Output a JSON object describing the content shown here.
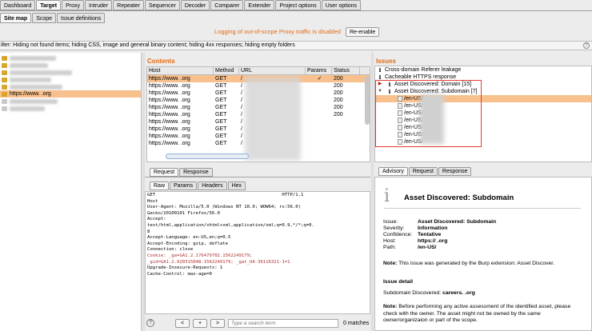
{
  "main_tabs": [
    "Dashboard",
    "Target",
    "Proxy",
    "Intruder",
    "Repeater",
    "Sequencer",
    "Decoder",
    "Comparer",
    "Extender",
    "Project options",
    "User options"
  ],
  "main_tab_active": "Target",
  "sub_tabs": [
    "Site map",
    "Scope",
    "Issue definitions"
  ],
  "scope_message": "Logging of out-of-scope Proxy traffic is disabled",
  "reenable_label": "Re-enable",
  "filter_text": "ilter: Hiding not found items;  hiding CSS, image and general binary content;  hiding 4xx responses;  hiding empty folders",
  "help_icon": "?",
  "site_tree": {
    "selected_label": "https://www.              .org"
  },
  "contents": {
    "title": "Contents",
    "columns": [
      "Host",
      "Method",
      "URL",
      "Params",
      "Status"
    ],
    "rows": [
      {
        "host": "https://www.          .org",
        "method": "GET",
        "url": "/",
        "params": "✓",
        "status": "200"
      },
      {
        "host": "https://www.          .org",
        "method": "GET",
        "url": "/",
        "params": "",
        "status": "200"
      },
      {
        "host": "https://www.          .org",
        "method": "GET",
        "url": "/",
        "params": "",
        "status": "200"
      },
      {
        "host": "https://www.          .org",
        "method": "GET",
        "url": "/",
        "params": "",
        "status": "200"
      },
      {
        "host": "https://www.          .org",
        "method": "GET",
        "url": "/",
        "params": "",
        "status": "200"
      },
      {
        "host": "https://www.          .org",
        "method": "GET",
        "url": "/",
        "params": "",
        "status": "200"
      },
      {
        "host": "https://www.          .org",
        "method": "GET",
        "url": "/",
        "params": "",
        "status": ""
      },
      {
        "host": "https://www.          .org",
        "method": "GET",
        "url": "/",
        "params": "",
        "status": ""
      },
      {
        "host": "https://www.          .org",
        "method": "GET",
        "url": "/",
        "params": "",
        "status": ""
      },
      {
        "host": "https://www.          .org",
        "method": "GET",
        "url": "/",
        "params": "",
        "status": ""
      }
    ]
  },
  "left_subtabs": [
    "Request",
    "Response"
  ],
  "left_subtab_active": "Request",
  "request_view_tabs": [
    "Raw",
    "Params",
    "Headers",
    "Hex"
  ],
  "request_view_active": "Raw",
  "request_lines": [
    "GET                                               HTTP/1.1",
    "Host",
    "User-Agent: Mozilla/5.0 (Windows NT 10.0; WOW64; rv:56.0)",
    "Gecko/20100101 Firefox/56.0",
    "Accept:",
    "text/html,application/xhtml+xml,application/xml;q=0.9,*/*;q=0.",
    "8",
    "Accept-Language: en-US,en;q=0.5",
    "Accept-Encoding: gzip, deflate",
    "Connection: close",
    "Cookie: _ga=GA1.2.176479702.1562249179;",
    "_gid=GA1.2.920315048.1562249179; _gat_UA-36116321-1=1",
    "Upgrade-Insecure-Requests: 1",
    "Cache-Control: max-age=0"
  ],
  "request_toolbar": {
    "help": "?",
    "prev": "<",
    "add": "+",
    "next": ">",
    "search_placeholder": "Type a search term",
    "matches": "0 matches"
  },
  "issues": {
    "title": "Issues",
    "items": [
      {
        "label": "Cross-domain Referer leakage",
        "kind": "info"
      },
      {
        "label": "Cacheable HTTPS response",
        "kind": "info"
      },
      {
        "label": "Asset Discovered: Domain [15]",
        "kind": "collapsed"
      },
      {
        "label": "Asset Discovered: Subdomain [7]",
        "kind": "expanded"
      }
    ],
    "subitems": [
      "/en-US/",
      "/en-US/",
      "/en-US/",
      "/en-US/",
      "/en-US/",
      "/en-US/",
      "/en-US/"
    ]
  },
  "right_subtabs": [
    "Advisory",
    "Request",
    "Response"
  ],
  "right_subtab_active": "Advisory",
  "advisory": {
    "icon": "i",
    "title": "Asset Discovered: Subdomain",
    "fields": [
      {
        "k": "Issue:",
        "v": "Asset Discovered: Subdomain"
      },
      {
        "k": "Severity:",
        "v": "Information"
      },
      {
        "k": "Confidence:",
        "v": "Tentative"
      },
      {
        "k": "Host:",
        "v": "https://               .org"
      },
      {
        "k": "Path:",
        "v": "/en-US/"
      }
    ],
    "note_label": "Note:",
    "note_text": " This issue was generated by the Burp extension: Asset Discover.",
    "detail_heading": "Issue detail",
    "detail_text": "Subdomain Discovered: ",
    "detail_value": "careers.              .org",
    "note2_label": "Note:",
    "note2_text": " Before performing any active assessment of the identified asset, please check with the owner. The asset might not be owned by the same owner/organizaion or part of the scope."
  }
}
